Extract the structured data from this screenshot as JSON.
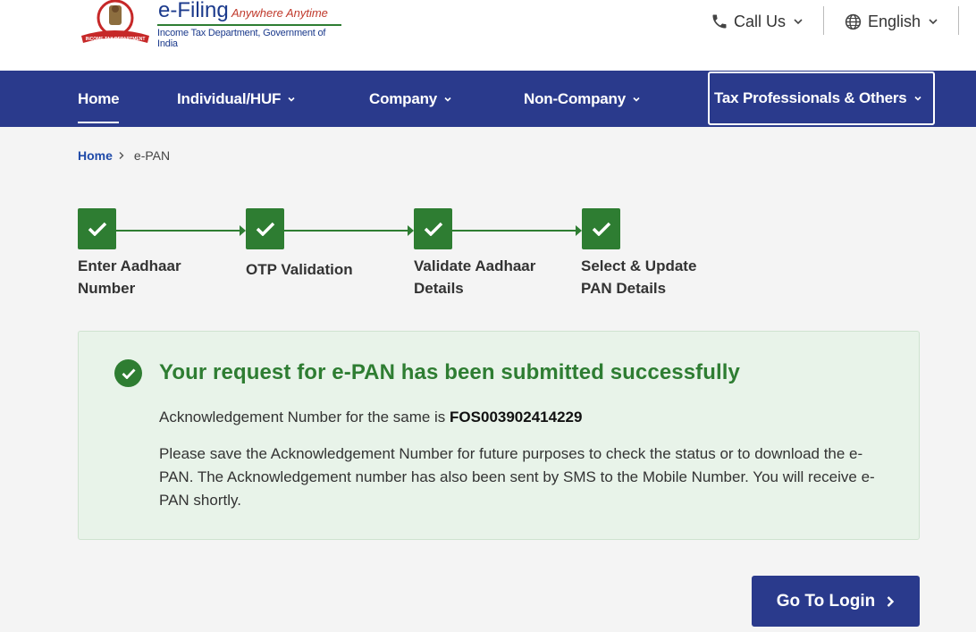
{
  "header": {
    "brand": "e-Filing",
    "tagline": "Anywhere Anytime",
    "department": "Income Tax Department, Government of India",
    "emblem_text": "INCOME TAX DEPARTMENT",
    "call_label": "Call Us",
    "language_label": "English"
  },
  "nav": {
    "items": [
      {
        "label": "Home",
        "active": true
      },
      {
        "label": "Individual/HUF"
      },
      {
        "label": "Company"
      },
      {
        "label": "Non-Company"
      },
      {
        "label": "Tax Professionals & Others",
        "focused": true
      }
    ]
  },
  "breadcrumb": {
    "home": "Home",
    "current": "e-PAN"
  },
  "steps": [
    {
      "label_line1": "Enter Aadhaar",
      "label_line2": "Number",
      "status": "complete"
    },
    {
      "label_line1": "OTP Validation",
      "label_line2": "",
      "status": "complete"
    },
    {
      "label_line1": "Validate Aadhaar",
      "label_line2": "Details",
      "status": "complete"
    },
    {
      "label_line1": "Select & Update",
      "label_line2": "PAN Details",
      "status": "complete"
    }
  ],
  "success": {
    "title": "Your request for e-PAN has been submitted successfully",
    "ack_prefix": "Acknowledgement Number for the same is",
    "ack_number": "FOS003902414229",
    "message": "Please save the Acknowledgement Number for future purposes to check the status or to download the e-PAN. The Acknowledgement number has also been sent by SMS to the Mobile Number. You will receive e-PAN shortly."
  },
  "actions": {
    "login_label": "Go To Login"
  },
  "colors": {
    "primary": "#2a3a8c",
    "success": "#2e7d32",
    "panel_bg": "#e8f3e9",
    "page_bg": "#f4f4f4"
  },
  "icons": {
    "phone": "phone-icon",
    "globe": "globe-icon",
    "check": "check-icon",
    "chevron": "chevron-right-icon"
  }
}
